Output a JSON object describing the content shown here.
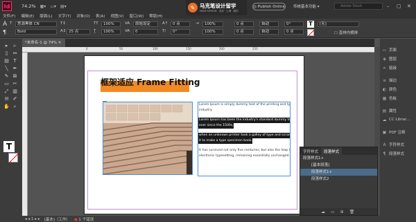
{
  "app": {
    "logo": "Id",
    "zoom": "74.2%",
    "publish": "Publish Online",
    "essentials": "传统基本功能",
    "search_placeholder": "Adobe Stock"
  },
  "brand": {
    "name": "马克笔设计留学",
    "tagline": "MAKE DESIGN · 北京 · 上海 · 纽约"
  },
  "menus": [
    "文件(F)",
    "编辑(E)",
    "版面(L)",
    "文字(T)",
    "对象(O)",
    "表(A)",
    "视图(V)",
    "窗口(W)",
    "帮助(H)"
  ],
  "control": {
    "font": "思源黑体 CN",
    "style": "Bold",
    "size": "12 点",
    "leading": "25 点",
    "scale_h": "100%",
    "scale_v": "100%",
    "tracking": "0",
    "kerning": "原始设定",
    "baseline": "0 点",
    "skew": "0°",
    "zero1": "0 点",
    "zero2": "0 点",
    "auto1": "自动",
    "auto2": "自动",
    "lang": "[无]",
    "swatch": "[无]",
    "pct1": "100%",
    "pct2": "100%",
    "rotate": "0°",
    "pt": "0 点",
    "checkbox": "直排内横排"
  },
  "document": {
    "tab": "*未命名-1 @ 74%",
    "ruler": [
      "0",
      "50",
      "100",
      "150",
      "200",
      "250"
    ]
  },
  "canvas": {
    "headline": "框架适应 Frame Fitting",
    "text_lines": [
      {
        "text": "Lorem Ipsum is simply dummy text of the printing and typesetting",
        "hl": false
      },
      {
        "text": "industry.",
        "hl": false
      },
      {
        "text": "",
        "hl": false
      },
      {
        "text": "Lorem Ipsum has been the industry's standard dummy text",
        "hl": true
      },
      {
        "text": "ever since the 1500s,",
        "hl": true
      },
      {
        "text": "",
        "hl": false
      },
      {
        "text": "when an unknown printer took a galley of type and scrambled",
        "hl": true
      },
      {
        "text": "it to make a type specimen book.",
        "hl": true
      },
      {
        "text": "",
        "hl": false
      },
      {
        "text": "It has survived not only five centuries, but also the leap into",
        "hl": false
      },
      {
        "text": "electronic typesetting, remaining essentially unchanged. It was",
        "hl": false
      }
    ]
  },
  "right_panel": {
    "items": [
      {
        "icon": "pages-icon",
        "glyph": "▭",
        "label": "页面"
      },
      {
        "icon": "layers-icon",
        "glyph": "◈",
        "label": "图层"
      },
      {
        "icon": "links-icon",
        "glyph": "∞",
        "label": "链接"
      },
      {
        "icon": "stroke-icon",
        "glyph": "≡",
        "label": "描边"
      },
      {
        "icon": "color-icon",
        "glyph": "◐",
        "label": "颜色"
      },
      {
        "icon": "swatches-icon",
        "glyph": "▦",
        "label": "色板"
      },
      {
        "icon": "attributes-icon",
        "glyph": "▤",
        "label": "属性"
      },
      {
        "icon": "cc-libraries-icon",
        "glyph": "☁",
        "label": "CC Librar..."
      },
      {
        "icon": "pdf-comment-icon",
        "glyph": "▣",
        "label": "PDF 注释"
      },
      {
        "icon": "char-styles-icon",
        "glyph": "A",
        "label": "字符样式"
      },
      {
        "icon": "para-styles-icon",
        "glyph": "¶",
        "label": "段落样式"
      }
    ]
  },
  "styles_panel": {
    "tab1": "字符样式",
    "tab2": "段落样式",
    "current": "段落样式1+",
    "rows": [
      "[基本段落]",
      "段落样式1+",
      "段落样式2"
    ],
    "selected": 1
  },
  "status": {
    "page": "1",
    "master": "[基本]（工作）",
    "errors": "1 个错误"
  }
}
